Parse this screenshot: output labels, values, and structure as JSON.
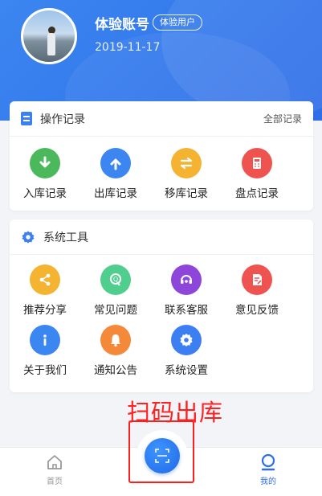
{
  "profile": {
    "name": "体验账号",
    "badge": "体验用户",
    "date": "2019-11-17"
  },
  "operation_records": {
    "title": "操作记录",
    "more_label": "全部记录",
    "items": [
      {
        "label": "入库记录",
        "icon": "download-arrow-icon",
        "color": "#4cb85c"
      },
      {
        "label": "出库记录",
        "icon": "upload-arrow-icon",
        "color": "#3b86f0"
      },
      {
        "label": "移库记录",
        "icon": "transfer-arrows-icon",
        "color": "#f5b332"
      },
      {
        "label": "盘点记录",
        "icon": "calculator-icon",
        "color": "#ef5350"
      }
    ]
  },
  "system_tools": {
    "title": "系统工具",
    "items": [
      {
        "label": "推荐分享",
        "icon": "share-icon",
        "color": "#f5b332"
      },
      {
        "label": "常见问题",
        "icon": "faq-icon",
        "color": "#4fce8d"
      },
      {
        "label": "联系客服",
        "icon": "headset-icon",
        "color": "#8e45d9"
      },
      {
        "label": "意见反馈",
        "icon": "feedback-icon",
        "color": "#ef5350"
      },
      {
        "label": "关于我们",
        "icon": "info-icon",
        "color": "#3b86f0"
      },
      {
        "label": "通知公告",
        "icon": "bell-icon",
        "color": "#f5893a"
      },
      {
        "label": "系统设置",
        "icon": "gear-icon",
        "color": "#3b7ff2"
      }
    ]
  },
  "annotation": {
    "text": "扫码出库",
    "color": "#ff2020"
  },
  "tabbar": {
    "home_label": "首页",
    "mine_label": "我的",
    "scan_icon": "scan-icon",
    "accent": "#2f6ee8"
  }
}
